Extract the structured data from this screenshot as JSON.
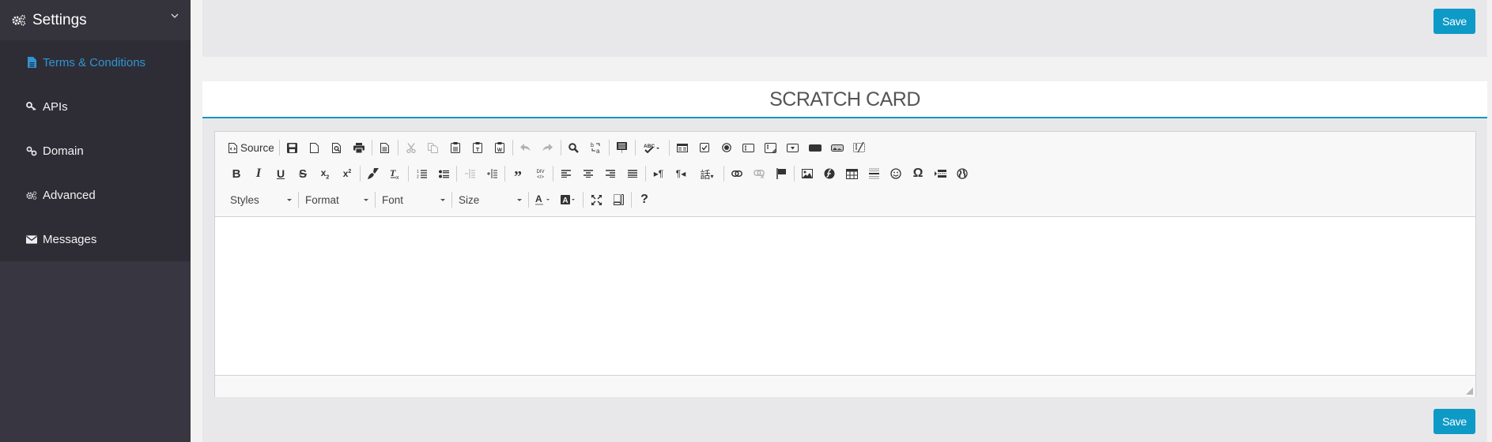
{
  "sidebar": {
    "header": {
      "title": "Settings",
      "icon": "gears-icon",
      "chevron": "chevron-down-icon"
    },
    "items": [
      {
        "label": "Terms & Conditions",
        "icon": "file-text-icon",
        "active": true
      },
      {
        "label": "APIs",
        "icon": "key-icon",
        "active": false
      },
      {
        "label": "Domain",
        "icon": "link-icon",
        "active": false
      },
      {
        "label": "Advanced",
        "icon": "gears-icon",
        "active": false
      },
      {
        "label": "Messages",
        "icon": "envelope-icon",
        "active": false
      }
    ]
  },
  "top": {
    "save_label": "Save"
  },
  "section": {
    "title": "SCRATCH CARD"
  },
  "editor": {
    "toolbar": {
      "source_label": "Source",
      "combos": {
        "styles": "Styles",
        "format": "Format",
        "font": "Font",
        "size": "Size"
      },
      "help_label": "?"
    },
    "content": ""
  },
  "bottom": {
    "save_label": "Save"
  },
  "colors": {
    "accent": "#0e9ac6",
    "active_link": "#2f95d3",
    "sidebar_bg": "#383641",
    "sidebar_sub_bg": "#2e2d36",
    "sidebar_header_bg": "#35343d"
  }
}
